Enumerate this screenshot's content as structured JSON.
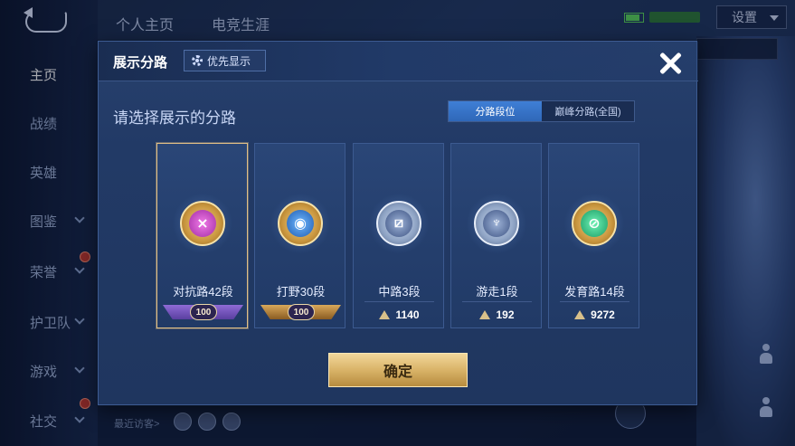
{
  "nav": {
    "items": [
      {
        "label": "主页",
        "active": true
      },
      {
        "label": "战绩"
      },
      {
        "label": "英雄"
      },
      {
        "label": "图鉴"
      },
      {
        "label": "荣誉"
      },
      {
        "label": "护卫队"
      },
      {
        "label": "游戏"
      },
      {
        "label": "社交"
      }
    ]
  },
  "top_tabs": [
    "个人主页",
    "电竞生涯"
  ],
  "settings_label": "设置",
  "bottom": {
    "recent_visit": "最近访客>"
  },
  "modal": {
    "title": "展示分路",
    "priority_label": "优先显示",
    "subtitle": "请选择展示的分路",
    "toggle": {
      "on": "分路段位",
      "off": "巅峰分路(全国)"
    },
    "cards": [
      {
        "label": "对抗路42段",
        "badge": "100",
        "emblem": "magenta",
        "frame": "gold",
        "selected": true
      },
      {
        "label": "打野30段",
        "badge": "100",
        "emblem": "blue",
        "frame": "gold"
      },
      {
        "label": "中路3段",
        "score": "1140",
        "emblem": "steel",
        "frame": "silver"
      },
      {
        "label": "游走1段",
        "score": "192",
        "emblem": "steel",
        "frame": "silver"
      },
      {
        "label": "发育路14段",
        "score": "9272",
        "emblem": "green",
        "frame": "gold"
      }
    ],
    "confirm_label": "确定"
  },
  "colors": {
    "accent_blue": "#3f7fd6",
    "gold": "#d9b368",
    "selected_border": "#e0bf86"
  }
}
